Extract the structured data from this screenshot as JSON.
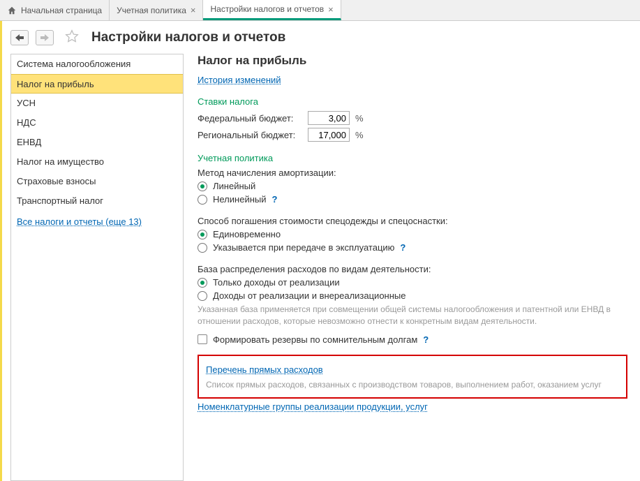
{
  "tabs": {
    "home": "Начальная страница",
    "t1": "Учетная политика",
    "t2": "Настройки налогов и отчетов"
  },
  "page_title": "Настройки налогов и отчетов",
  "sidebar": {
    "items": [
      "Система налогообложения",
      "Налог на прибыль",
      "УСН",
      "НДС",
      "ЕНВД",
      "Налог на имущество",
      "Страховые взносы",
      "Транспортный налог"
    ],
    "all_link": "Все налоги и отчеты (еще 13)"
  },
  "main": {
    "heading": "Налог на прибыль",
    "history_link": "История изменений",
    "rates_heading": "Ставки налога",
    "federal_label": "Федеральный бюджет:",
    "federal_value": "3,00",
    "regional_label": "Региональный бюджет:",
    "regional_value": "17,000",
    "percent": "%",
    "policy_heading": "Учетная политика",
    "amort_label": "Метод начисления амортизации:",
    "amort_linear": "Линейный",
    "amort_nonlinear": "Нелинейный",
    "workwear_label": "Способ погашения стоимости спецодежды и спецоснастки:",
    "workwear_once": "Единовременно",
    "workwear_ontransfer": "Указывается при передаче в эксплуатацию",
    "base_label": "База распределения расходов по видам деятельности:",
    "base_sales": "Только доходы от реализации",
    "base_all": "Доходы от реализации и внереализационные",
    "base_desc": "Указанная база применяется при совмещении общей системы налогообложения и патентной или ЕНВД в отношении расходов, которые невозможно отнести к конкретным видам деятельности.",
    "reserve_label": "Формировать резервы по сомнительным долгам",
    "direct_link": "Перечень прямых расходов",
    "direct_desc": "Список прямых расходов, связанных с производством товаров, выполнением работ, оказанием услуг",
    "nomenclature_link": "Номенклатурные группы реализации продукции, услуг",
    "help": "?"
  }
}
